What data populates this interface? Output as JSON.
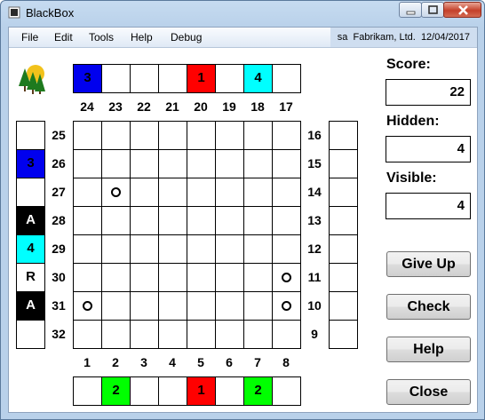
{
  "window": {
    "title": "BlackBox"
  },
  "menu": [
    "File",
    "Edit",
    "Tools",
    "Help",
    "Debug"
  ],
  "status": {
    "user": "sa",
    "company": "Fabrikam, Ltd.",
    "date": "12/04/2017"
  },
  "board": {
    "top_numbers": [
      "24",
      "23",
      "22",
      "21",
      "20",
      "19",
      "18",
      "17"
    ],
    "bottom_numbers": [
      "1",
      "2",
      "3",
      "4",
      "5",
      "6",
      "7",
      "8"
    ],
    "left_numbers": [
      "25",
      "26",
      "27",
      "28",
      "29",
      "30",
      "31",
      "32"
    ],
    "right_numbers": [
      "16",
      "15",
      "14",
      "13",
      "12",
      "11",
      "10",
      "9"
    ],
    "top_cells": [
      {
        "text": "3",
        "color": "#0000ee",
        "fg": "#000"
      },
      {
        "text": "",
        "color": "#ffffff",
        "fg": "#000"
      },
      {
        "text": "",
        "color": "#ffffff",
        "fg": "#000"
      },
      {
        "text": "",
        "color": "#ffffff",
        "fg": "#000"
      },
      {
        "text": "1",
        "color": "#ff0000",
        "fg": "#000"
      },
      {
        "text": "",
        "color": "#ffffff",
        "fg": "#000"
      },
      {
        "text": "4",
        "color": "#00ffff",
        "fg": "#000"
      },
      {
        "text": "",
        "color": "#ffffff",
        "fg": "#000"
      }
    ],
    "bottom_cells": [
      {
        "text": "",
        "color": "#ffffff",
        "fg": "#000"
      },
      {
        "text": "2",
        "color": "#00ff00",
        "fg": "#000"
      },
      {
        "text": "",
        "color": "#ffffff",
        "fg": "#000"
      },
      {
        "text": "",
        "color": "#ffffff",
        "fg": "#000"
      },
      {
        "text": "1",
        "color": "#ff0000",
        "fg": "#000"
      },
      {
        "text": "",
        "color": "#ffffff",
        "fg": "#000"
      },
      {
        "text": "2",
        "color": "#00ff00",
        "fg": "#000"
      },
      {
        "text": "",
        "color": "#ffffff",
        "fg": "#000"
      }
    ],
    "left_cells": [
      {
        "text": "",
        "color": "#ffffff",
        "fg": "#000"
      },
      {
        "text": "3",
        "color": "#0000ee",
        "fg": "#000"
      },
      {
        "text": "",
        "color": "#ffffff",
        "fg": "#000"
      },
      {
        "text": "A",
        "color": "#000000",
        "fg": "#ffffff"
      },
      {
        "text": "4",
        "color": "#00ffff",
        "fg": "#000"
      },
      {
        "text": "R",
        "color": "#ffffff",
        "fg": "#000"
      },
      {
        "text": "A",
        "color": "#000000",
        "fg": "#ffffff"
      },
      {
        "text": "",
        "color": "#ffffff",
        "fg": "#000"
      }
    ],
    "right_cells": [
      {
        "text": "",
        "color": "#ffffff",
        "fg": "#000"
      },
      {
        "text": "",
        "color": "#ffffff",
        "fg": "#000"
      },
      {
        "text": "",
        "color": "#ffffff",
        "fg": "#000"
      },
      {
        "text": "",
        "color": "#ffffff",
        "fg": "#000"
      },
      {
        "text": "",
        "color": "#ffffff",
        "fg": "#000"
      },
      {
        "text": "",
        "color": "#ffffff",
        "fg": "#000"
      },
      {
        "text": "",
        "color": "#ffffff",
        "fg": "#000"
      },
      {
        "text": "",
        "color": "#ffffff",
        "fg": "#000"
      }
    ],
    "markers": [
      {
        "row": 2,
        "col": 1
      },
      {
        "row": 5,
        "col": 7
      },
      {
        "row": 6,
        "col": 0
      },
      {
        "row": 6,
        "col": 7
      }
    ]
  },
  "stats": {
    "score_label": "Score:",
    "score_value": "22",
    "hidden_label": "Hidden:",
    "hidden_value": "4",
    "visible_label": "Visible:",
    "visible_value": "4"
  },
  "buttons": {
    "give_up": "Give Up",
    "check": "Check",
    "help": "Help",
    "close": "Close"
  },
  "icons": {
    "logo": "trees-sun-icon",
    "app": "blackbox-app-icon"
  }
}
